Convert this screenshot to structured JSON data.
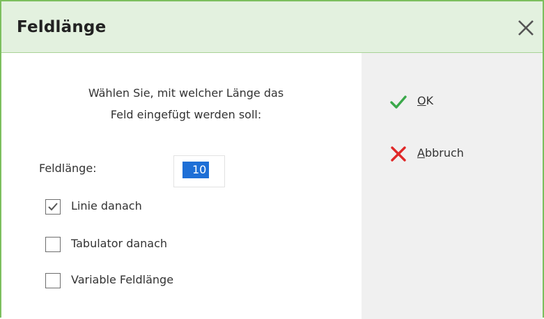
{
  "dialog": {
    "title": "Feldlänge",
    "prompt_line1": "Wählen Sie, mit welcher Länge das",
    "prompt_line2": "Feld eingefügt werden soll:"
  },
  "field_length": {
    "label": "Feldlänge:",
    "value": "10"
  },
  "options": [
    {
      "label": "Linie danach",
      "checked": true
    },
    {
      "label": "Tabulator danach",
      "checked": false
    },
    {
      "label": "Variable Feldlänge",
      "checked": false
    }
  ],
  "actions": {
    "ok": {
      "mnemonic": "O",
      "rest": "K",
      "icon": "checkmark-icon",
      "color": "#3aa84a"
    },
    "cancel": {
      "mnemonic": "A",
      "rest": "bbruch",
      "icon": "cross-icon",
      "color": "#e02828"
    }
  },
  "colors": {
    "accent_border": "#7cbf5e",
    "titlebar_bg": "#e3f1df",
    "selection": "#1e6fd6",
    "side_panel_bg": "#f0f0f0"
  }
}
